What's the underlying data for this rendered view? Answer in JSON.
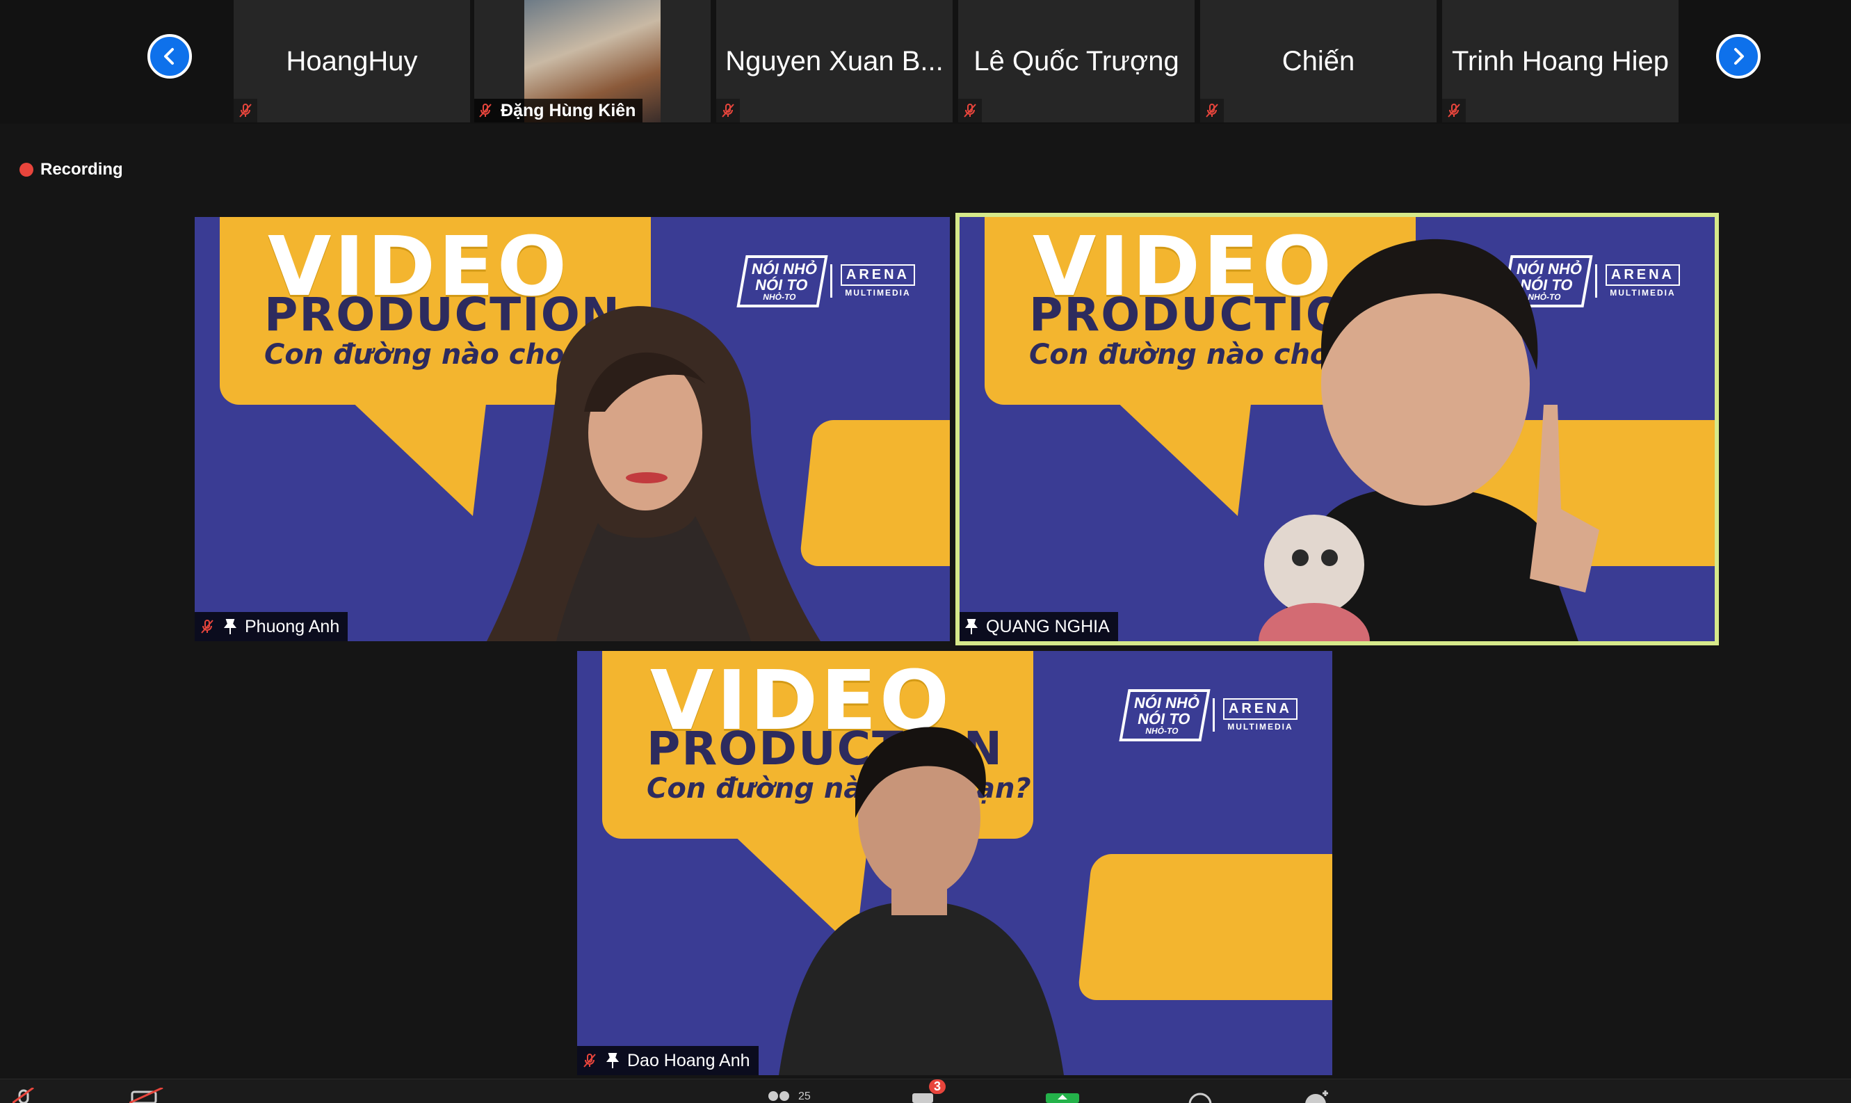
{
  "gallery_strip": {
    "participants": [
      {
        "name": "HoangHuy",
        "type": "name-only"
      },
      {
        "name": "Đặng Hùng Kiên",
        "type": "video"
      },
      {
        "name": "Nguyen Xuan B...",
        "type": "name-only"
      },
      {
        "name": "Lê Quốc Trượng",
        "type": "name-only"
      },
      {
        "name": "Chiến",
        "type": "name-only"
      },
      {
        "name": "Trinh Hoang Hiep",
        "type": "name-only"
      }
    ],
    "prev_icon": "chevron-left-icon",
    "next_icon": "chevron-right-icon"
  },
  "recording": {
    "label": "Recording",
    "color": "#e8453c"
  },
  "background": {
    "title": "VIDEO",
    "subtitle": "PRODUCTION",
    "tagline": "Con đường nào cho bạn?",
    "logo_left_top": "NÓI NHỎ",
    "logo_left_mid": "NÓI TO",
    "logo_left_bottom": "NHỎ-TO",
    "logo_right": "ARENA",
    "logo_right_sub": "MULTIMEDIA",
    "colors": {
      "bg": "#3a3c94",
      "yellow": "#f3b52f",
      "navy": "#2d2b5e"
    }
  },
  "tiles": [
    {
      "name": "Phuong Anh",
      "muted": true,
      "pinned": true,
      "active": false
    },
    {
      "name": "QUANG NGHIA",
      "muted": false,
      "pinned": true,
      "active": true
    },
    {
      "name": "Dao Hoang Anh",
      "muted": true,
      "pinned": true,
      "active": false
    }
  ],
  "toolbar": {
    "chat_badge": "3",
    "participants_count": "25"
  },
  "colors": {
    "accent": "#0e71eb",
    "active_border": "#d6e98a",
    "mute_red": "#e8453c"
  }
}
